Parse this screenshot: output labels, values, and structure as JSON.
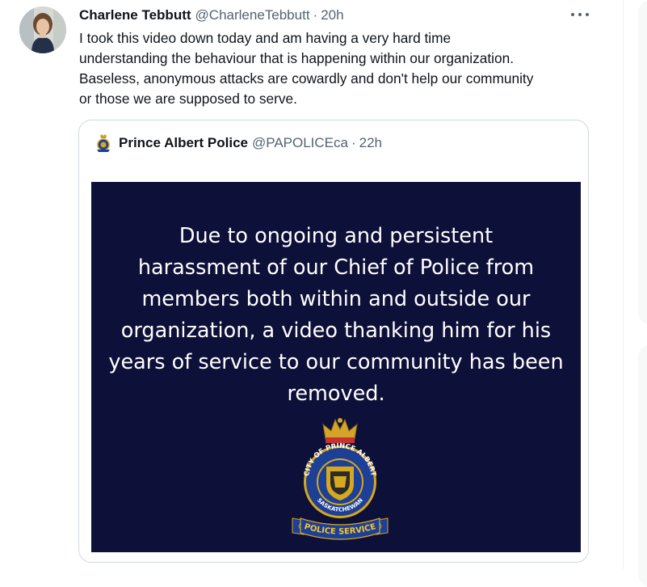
{
  "tweet": {
    "author_name": "Charlene Tebbutt",
    "author_handle": "@CharleneTebbutt",
    "separator": "·",
    "time": "20h",
    "more_icon": "more-horizontal-icon",
    "text_lines": [
      "I took this video down today and am having a very hard time",
      "understanding the behaviour that is happening within our organization.",
      "Baseless, anonymous attacks are cowardly and don't help our community",
      "or those we are supposed to serve."
    ]
  },
  "quote": {
    "author_name": "Prince Albert Police",
    "author_handle": "@PAPOLICEca",
    "separator": "·",
    "time": "22h",
    "media": {
      "background": "#0d1038",
      "text_lines": [
        "Due to ongoing and persistent",
        "harassment of our Chief of Police from",
        "members both within and outside our",
        "organization, a video thanking him for his",
        "years of service to our community has been",
        "removed."
      ],
      "badge": {
        "ring_text": "CITY OF PRINCE ALBERT",
        "province_text": "SASKATCHEWAN",
        "banner_text": "POLICE SERVICE"
      }
    }
  },
  "colors": {
    "text_primary": "#0f1419",
    "text_secondary": "#536471",
    "border": "#cfd9de",
    "badge_blue": "#1d3f95",
    "badge_gold": "#d6a81f"
  }
}
